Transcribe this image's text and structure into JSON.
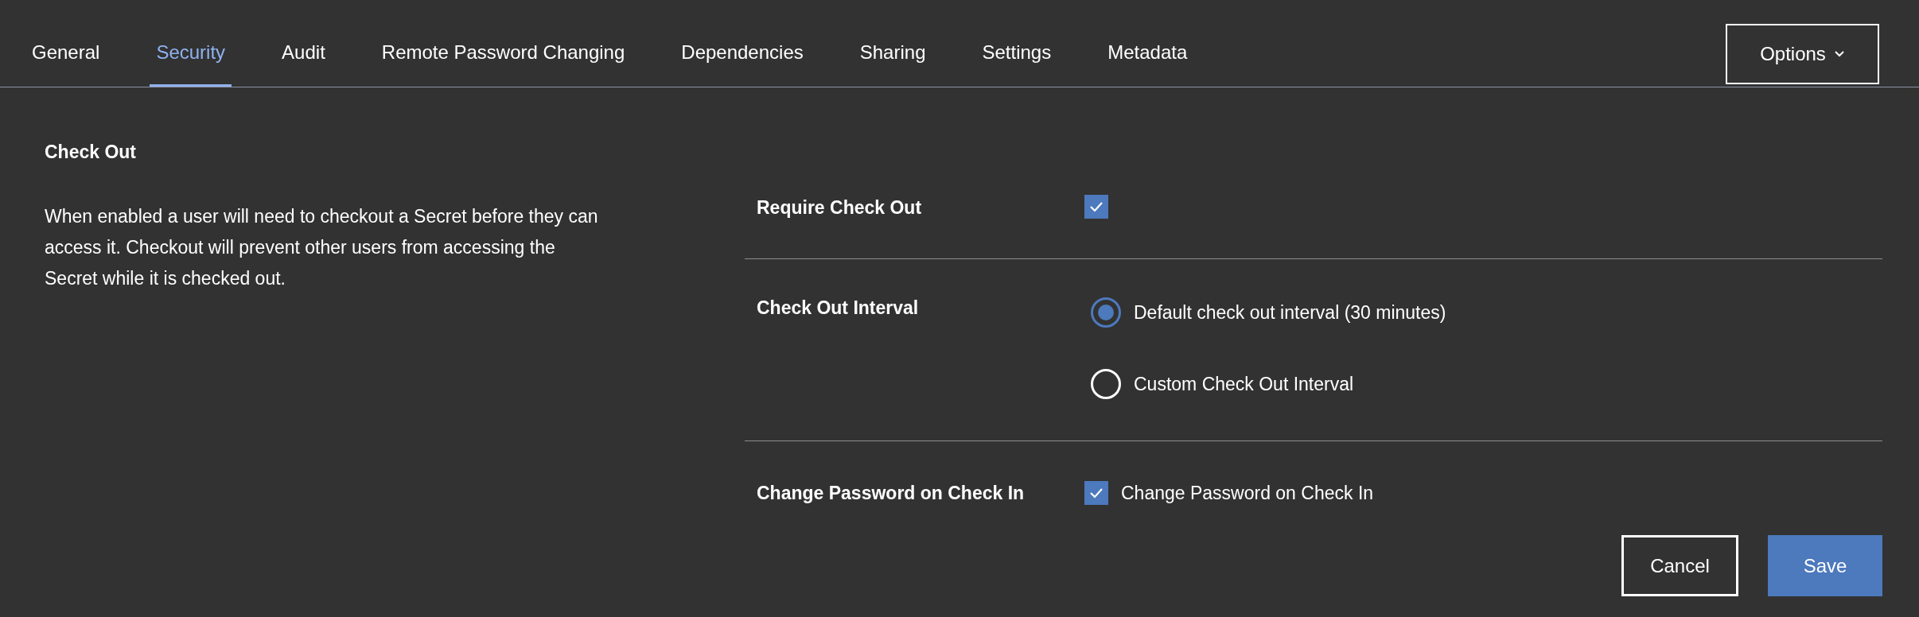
{
  "tabs": [
    {
      "label": "General",
      "selected": false
    },
    {
      "label": "Security",
      "selected": true
    },
    {
      "label": "Audit",
      "selected": false
    },
    {
      "label": "Remote Password Changing",
      "selected": false
    },
    {
      "label": "Dependencies",
      "selected": false
    },
    {
      "label": "Sharing",
      "selected": false
    },
    {
      "label": "Settings",
      "selected": false
    },
    {
      "label": "Metadata",
      "selected": false
    }
  ],
  "options_button": {
    "label": "Options"
  },
  "section": {
    "title": "Check Out",
    "description": "When enabled a user will need to checkout a Secret before they can access it. Checkout will prevent other users from accessing the Secret while it is checked out."
  },
  "settings": [
    {
      "kind": "checkbox",
      "label": "Require Check Out",
      "checked": true
    },
    {
      "kind": "radio_group",
      "label": "Check Out Interval",
      "options": [
        {
          "label": "Default check out interval (30 minutes)",
          "selected": true
        },
        {
          "label": "Custom Check Out Interval",
          "selected": false
        }
      ]
    },
    {
      "kind": "checkbox",
      "label": "Change Password on Check In",
      "checked": true,
      "option_label": "Change Password on Check In"
    }
  ],
  "buttons": [
    {
      "label": "Cancel",
      "kind": "secondary"
    },
    {
      "label": "Save",
      "kind": "primary"
    }
  ]
}
